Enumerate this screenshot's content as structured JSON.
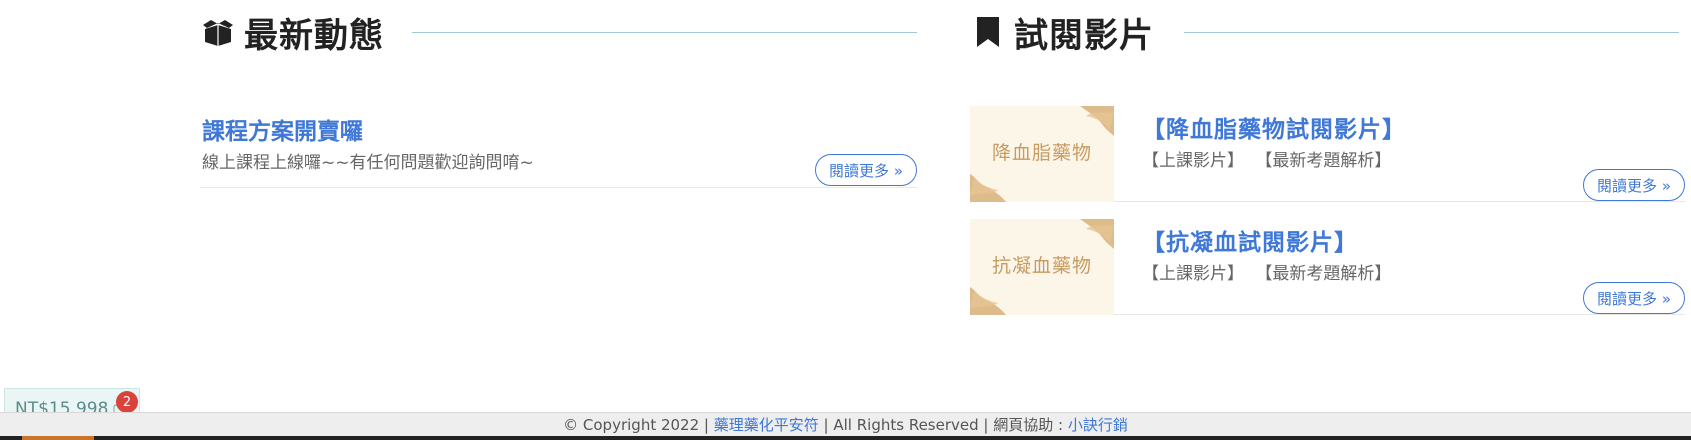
{
  "news_section": {
    "heading": "最新動態",
    "icon": "box-icon",
    "items": [
      {
        "title": "課程方案開賣囉",
        "description": "線上課程上線囉~~有任何問題歡迎詢問唷~",
        "read_more": "閱讀更多 »"
      }
    ]
  },
  "video_section": {
    "heading": "試閱影片",
    "icon": "bookmark-icon",
    "items": [
      {
        "title": "【降血脂藥物試閱影片】",
        "thumb_text": "降血脂藥物",
        "tags": [
          "【上課影片】",
          "【最新考題解析】"
        ],
        "read_more": "閱讀更多 »"
      },
      {
        "title": "【抗凝血試閱影片】",
        "thumb_text": "抗凝血藥物",
        "tags": [
          "【上課影片】",
          "【最新考題解析】"
        ],
        "read_more": "閱讀更多 »"
      }
    ]
  },
  "cart": {
    "total": "NT$15,998",
    "badge_count": "2",
    "icon": "shopping-bag-icon"
  },
  "footer": {
    "copyright": "© Copyright 2022 |",
    "site_link": "藥理藥化平安符",
    "rights": " | All Rights Reserved | 網頁協助 :",
    "helper_link": "小訣行銷"
  },
  "colors": {
    "accent": "#3f78d6",
    "rule": "#9fc9d7",
    "thumb_bg": "#fcf6e8",
    "thumb_text": "#c89b62",
    "badge": "#d9433b",
    "cart_bg": "#e9f6f5"
  }
}
